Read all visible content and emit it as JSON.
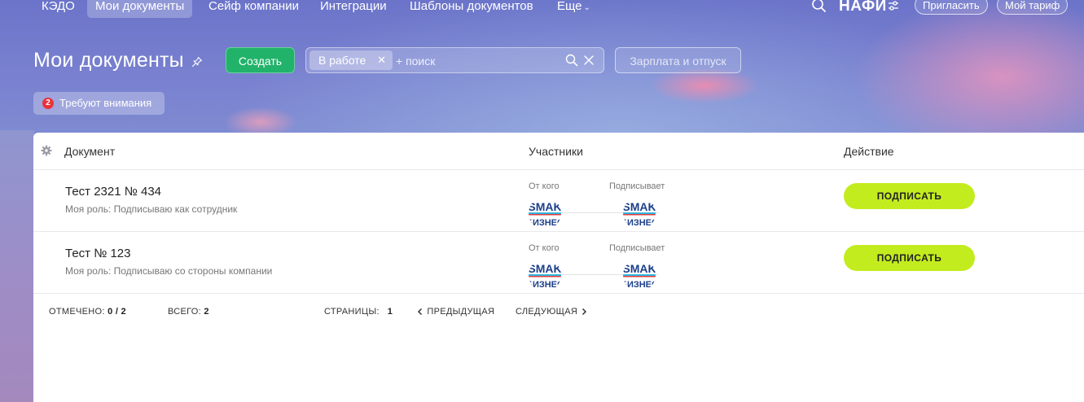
{
  "nav": {
    "items": [
      {
        "label": "КЭДО"
      },
      {
        "label": "Мои документы"
      },
      {
        "label": "Сейф компании"
      },
      {
        "label": "Интеграции"
      },
      {
        "label": "Шаблоны документов"
      },
      {
        "label": "Еще"
      }
    ],
    "brand": "НАФИ",
    "invite_label": "Пригласить",
    "tariff_label": "Мой тариф"
  },
  "header": {
    "title": "Мои документы",
    "create_label": "Создать",
    "filter_chip": "В работе",
    "search_placeholder": "+ поиск",
    "salary_label": "Зарплата и отпуск",
    "attention_count": "2",
    "attention_label": "Требуют внимания"
  },
  "table": {
    "columns": {
      "document": "Документ",
      "participants": "Участники",
      "action": "Действие"
    },
    "rows": [
      {
        "title": "Тест 2321 № 434",
        "role": "Моя роль: Подписываю как сотрудник",
        "from_label": "От кого",
        "signer_label": "Подписывает",
        "action_label": "ПОДПИСАТЬ"
      },
      {
        "title": "Тест № 123",
        "role": "Моя роль: Подписываю со стороны компании",
        "from_label": "От кого",
        "signer_label": "Подписывает",
        "action_label": "ПОДПИСАТЬ"
      }
    ]
  },
  "footer": {
    "marked_label": "ОТМЕЧЕНО:",
    "marked_value": "0 / 2",
    "total_label": "ВСЕГО:",
    "total_value": "2",
    "pages_label": "СТРАНИЦЫ:",
    "pages_value": "1",
    "prev_label": "ПРЕДЫДУЩАЯ",
    "next_label": "СЛЕДУЮЩАЯ"
  },
  "avatar": {
    "text_top": "SMAK",
    "text_bottom": "БИЗНЕС"
  },
  "colors": {
    "accent_green": "#22b36b",
    "sign_lime": "#c3ec1f",
    "badge_red": "#e8333a"
  }
}
